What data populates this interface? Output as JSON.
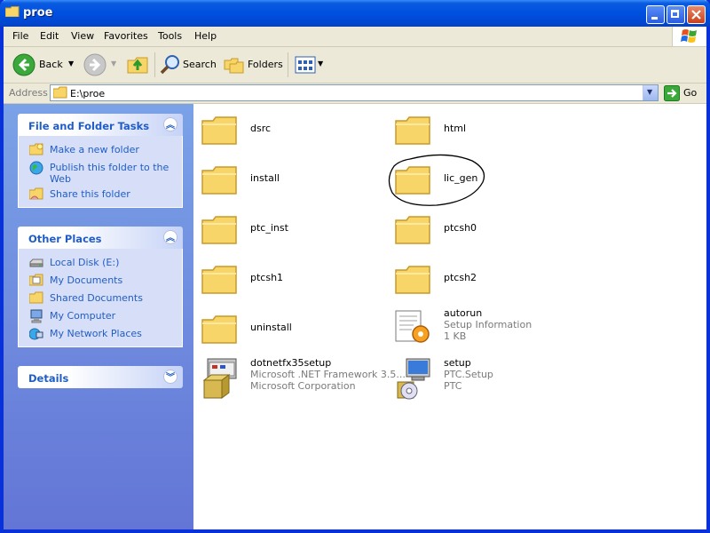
{
  "window": {
    "title": "proe"
  },
  "menu": [
    "File",
    "Edit",
    "View",
    "Favorites",
    "Tools",
    "Help"
  ],
  "toolbar": {
    "back": "Back",
    "search": "Search",
    "folders": "Folders"
  },
  "address": {
    "label": "Address",
    "value": "E:\\proe",
    "go": "Go"
  },
  "tasks": {
    "title": "File and Folder Tasks",
    "items": [
      "Make a new folder",
      "Publish this folder to the Web",
      "Share this folder"
    ]
  },
  "places": {
    "title": "Other Places",
    "items": [
      "Local Disk (E:)",
      "My Documents",
      "Shared Documents",
      "My Computer",
      "My Network Places"
    ]
  },
  "details": {
    "title": "Details"
  },
  "files": [
    {
      "name": "dsrc",
      "type": "folder"
    },
    {
      "name": "html",
      "type": "folder"
    },
    {
      "name": "install",
      "type": "folder"
    },
    {
      "name": "lic_gen",
      "type": "folder"
    },
    {
      "name": "ptc_inst",
      "type": "folder"
    },
    {
      "name": "ptcsh0",
      "type": "folder"
    },
    {
      "name": "ptcsh1",
      "type": "folder"
    },
    {
      "name": "ptcsh2",
      "type": "folder"
    },
    {
      "name": "uninstall",
      "type": "folder"
    },
    {
      "name": "autorun",
      "type": "setup-info",
      "line2": "Setup Information",
      "line3": "1 KB"
    },
    {
      "name": "dotnetfx35setup",
      "type": "installer",
      "line2": "Microsoft .NET Framework 3.5...",
      "line3": "Microsoft Corporation"
    },
    {
      "name": "setup",
      "type": "setup-exe",
      "line2": "PTC.Setup",
      "line3": "PTC"
    }
  ],
  "colors": {
    "title_bar": "#0054e3",
    "task_pane": "#7ba2e7",
    "link": "#215dc6",
    "annotation": "#000000"
  }
}
